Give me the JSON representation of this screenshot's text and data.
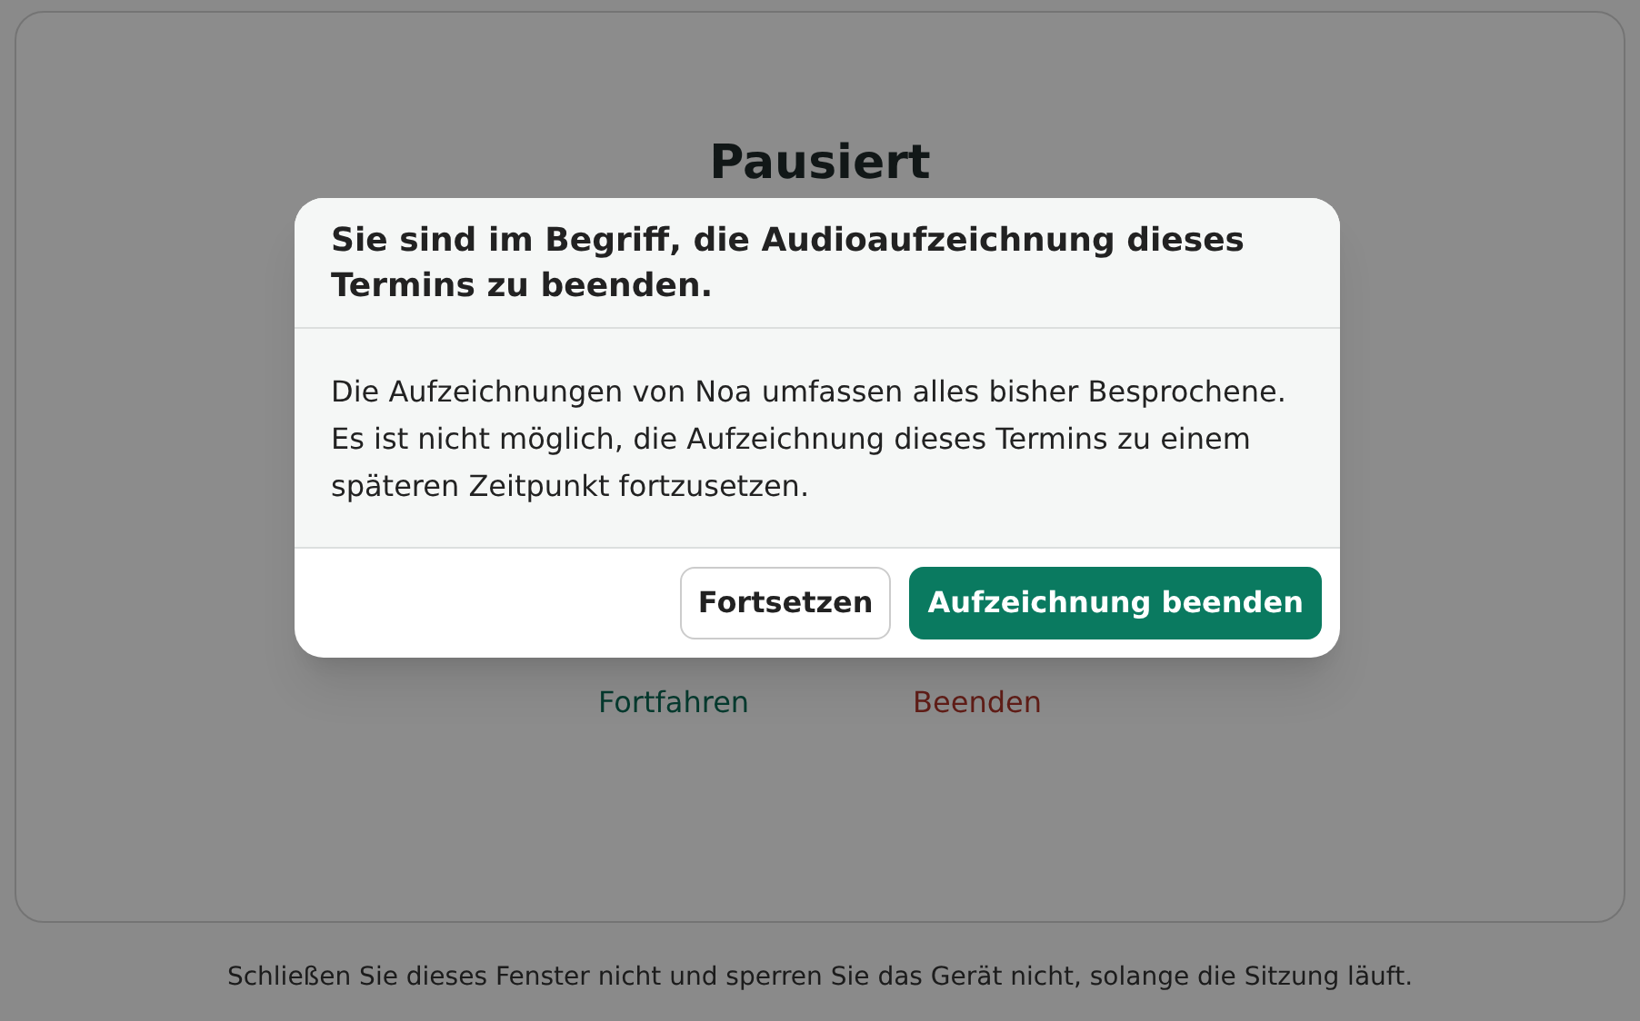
{
  "session": {
    "status_title": "Pausiert",
    "actions": [
      {
        "kind": "resume",
        "label": "Fortfahren"
      },
      {
        "kind": "stop",
        "label": "Beenden"
      }
    ]
  },
  "footer_note": "Schließen Sie dieses Fenster nicht und sperren Sie das Gerät nicht, solange die Sitzung läuft.",
  "dialog": {
    "title": "Sie sind im Begriff, die Audioaufzeichnung dieses Termins zu beenden.",
    "body": "Die Aufzeichnungen von Noa umfassen alles bisher Besprochene. Es ist nicht möglich, die Aufzeichnung dieses Termins zu einem späteren Zeitpunkt fortzusetzen.",
    "buttons": [
      {
        "kind": "secondary",
        "label": "Fortsetzen"
      },
      {
        "kind": "primary",
        "label": "Aufzeichnung beenden"
      }
    ]
  }
}
